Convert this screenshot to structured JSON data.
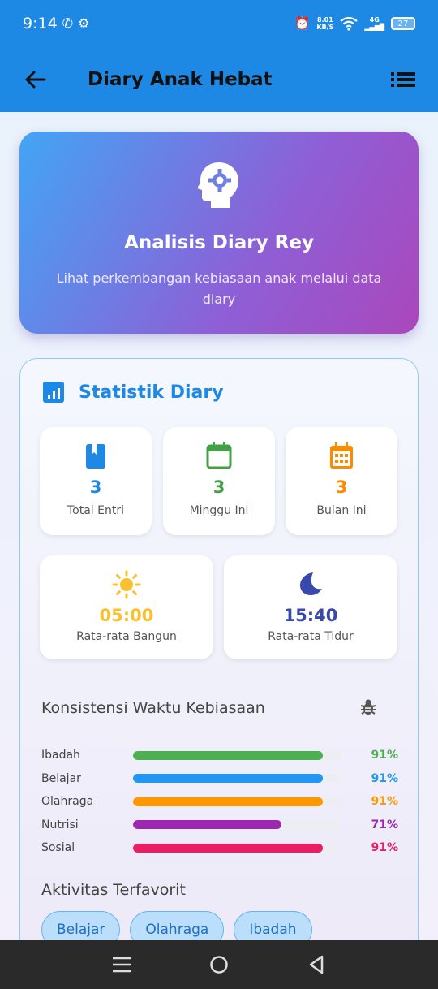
{
  "status_bar": {
    "time": "9:14",
    "net_speed_value": "8.01",
    "net_speed_unit": "KB/S",
    "network": "4G",
    "battery": "27"
  },
  "app_bar": {
    "title": "Diary Anak Hebat"
  },
  "hero": {
    "title": "Analisis Diary Rey",
    "subtitle": "Lihat perkembangan kebiasaan anak melalui data diary"
  },
  "stats": {
    "title": "Statistik Diary",
    "counts": [
      {
        "value": "3",
        "label": "Total Entri",
        "color": "#1e88e5",
        "icon": "book-icon"
      },
      {
        "value": "3",
        "label": "Minggu Ini",
        "color": "#43a047",
        "icon": "calendar-icon"
      },
      {
        "value": "3",
        "label": "Bulan Ini",
        "color": "#fb8c00",
        "icon": "calendar-month-icon"
      }
    ],
    "times": [
      {
        "value": "05:00",
        "label": "Rata-rata Bangun",
        "color": "#fbc02d",
        "icon": "sun-icon"
      },
      {
        "value": "15:40",
        "label": "Rata-rata Tidur",
        "color": "#3949ab",
        "icon": "moon-icon"
      }
    ]
  },
  "consistency": {
    "title": "Konsistensi Waktu Kebiasaan",
    "items": [
      {
        "label": "Ibadah",
        "percent": 91,
        "percent_text": "91%",
        "color": "#4caf50"
      },
      {
        "label": "Belajar",
        "percent": 91,
        "percent_text": "91%",
        "color": "#2196f3"
      },
      {
        "label": "Olahraga",
        "percent": 91,
        "percent_text": "91%",
        "color": "#ff9800"
      },
      {
        "label": "Nutrisi",
        "percent": 71,
        "percent_text": "71%",
        "color": "#9c27b0"
      },
      {
        "label": "Sosial",
        "percent": 91,
        "percent_text": "91%",
        "color": "#e91e63"
      }
    ]
  },
  "favorites": {
    "title": "Aktivitas Terfavorit",
    "chips": [
      "Belajar",
      "Olahraga",
      "Ibadah"
    ]
  }
}
